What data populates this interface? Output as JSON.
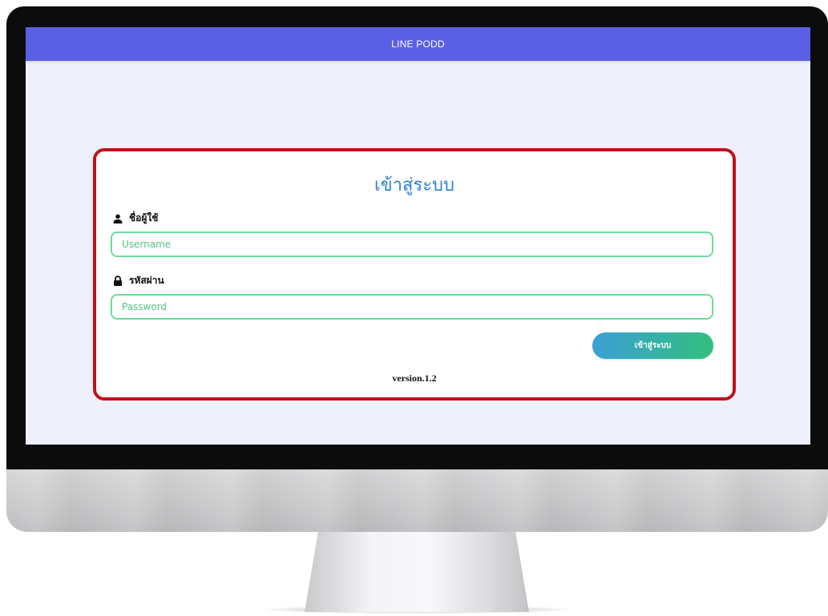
{
  "app": {
    "title": "LINE PODD"
  },
  "login": {
    "heading": "เข้าสู่ระบบ",
    "username": {
      "label": "ชื่อผู้ใช้",
      "icon": "user-icon",
      "placeholder": "Username",
      "value": ""
    },
    "password": {
      "label": "รหัสผ่าน",
      "icon": "lock-icon",
      "placeholder": "Password",
      "value": ""
    },
    "submit_label": "เข้าสู่ระบบ",
    "version": "version.1.2"
  },
  "colors": {
    "header": "#5b5fe4",
    "background": "#eef0fb",
    "card_border": "#c0111b",
    "heading": "#2f7fd4",
    "field_border": "#6ddc9a",
    "button_gradient_start": "#3b9fd6",
    "button_gradient_end": "#31c07d"
  }
}
